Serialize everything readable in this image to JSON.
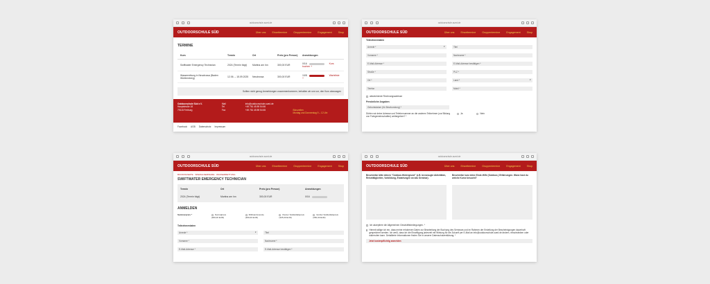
{
  "colors": {
    "brand": "#b31b1b",
    "accent": "#f3d04b"
  },
  "common": {
    "url": "outdoorschule-sued.de",
    "brand": "OUTDOORSCHULE SÜD",
    "menu": [
      "Über uns",
      "Einzeltermine",
      "Gruppentermine",
      "Engagement",
      "Shop"
    ]
  },
  "w1": {
    "heading": "TERMINE",
    "headers": [
      "Kurs",
      "Termin",
      "Ort",
      "Preis (pro Person)",
      "Anmeldungen"
    ],
    "rows": [
      {
        "kurs": "Swiftwater Emergency Technician",
        "termin": "2024 (Termin folgt)",
        "ort": "Martina am Inn",
        "preis": "300,00 EUR",
        "count": "0/16",
        "action": "Kurs buchen"
      },
      {
        "kurs": "Wasserrettung in Neudrossa (Baden Württemberg)",
        "termin": "12.06. – 15.09.2025",
        "ort": "Neudrossa",
        "preis": "300,00 EUR",
        "count": "10/8",
        "action": "Warteliste"
      }
    ],
    "notice": "Sollten nicht genug Anmeldungen zusammenkommen, behalten wir uns vor, den Kurs abzusagen",
    "footer": {
      "c1": [
        "Outdoorschule Süd e.V.",
        "Hauptstraße 18",
        "79115 Freiburg"
      ],
      "c2": [
        "Mail",
        "Tel",
        "Fax"
      ],
      "c3": [
        "info@outdoorschule-sued.de",
        "+49 761 45 89 54 66",
        "+49 761 45 89 54 65"
      ],
      "c4": [
        "",
        "",
        "Bürozeiten",
        "Montag und Donnerstag 9 – 12 Uhr"
      ]
    },
    "legal": [
      "Facebook",
      "AGB",
      "Datenschutz",
      "Impressum"
    ]
  },
  "w2": {
    "section": "Teilnehmerdaten",
    "fields": [
      [
        "Anrede *",
        "Titel"
      ],
      [
        "Vorname *",
        "Nachname *"
      ],
      [
        "E-Mail-Adresse *",
        "E-Mail-Adresse bestätigen *"
      ],
      [
        "Straße *",
        "PLZ *"
      ],
      [
        "Ort *",
        "Land *"
      ],
      [
        "Telefon",
        "Mobil *"
      ]
    ],
    "check": "abweichende Rechnungsadresse",
    "personal": "Persönliche Angaben",
    "birth": "Geburtsdatum (für Beurkundung) *",
    "question": "Dürfen wir deine Adresse und Telefonnummer an die anderen Teilnehmer (zur Bildung von Fahrgemeinschaften) weitergeben? *",
    "yes": "Ja",
    "no": "Nein"
  },
  "w3": {
    "crumb": "BOOKINGSEITE · SPEZIALSEMINARE · WASSERRETTUNG",
    "title": "SWIFTWATER EMERGENCY TECHNICIAN",
    "headers": [
      "Termin",
      "Ort",
      "Preis (pro Person)",
      "Anmeldungen"
    ],
    "row": [
      "2024 (Termin folgt)",
      "Martina am Inn",
      "300,00 EUR",
      "0/16"
    ],
    "anmelden": "ANMELDEN",
    "preis_label": "Seminarpreis *",
    "prices": [
      [
        "Normalpreis",
        "(300,00 EUR)"
      ],
      [
        "Mitfinanzierende",
        "(300,00 EUR)"
      ],
      [
        "Kleiner Solidaritätspreis",
        "(325,00 EUR)"
      ],
      [
        "Großer Solidaritätspreis",
        "(350,00 EUR)"
      ]
    ],
    "section": "Teilnehmerdaten",
    "fields": [
      [
        "Anrede *",
        "Titel"
      ],
      [
        "Vorname *",
        "Nachname *"
      ],
      [
        "E-Mail-Adresse *",
        "E-Mail-Adresse bestätigen *"
      ]
    ]
  },
  "w4": {
    "q1": "Beschreibe bitte deinen \"Outdoor-Hintergrund\" (z.B. bevorzugte Aktivitäten, Reisetätigkeiten, Vorbildung, Erwartungen an das Seminar).",
    "q2": "Beschreibe kurz deine Erste-Hilfe (Outdoor-) Erfahrungen. Wann hast du welche Kurse besucht?",
    "agb": "Ich akzeptiere die Allgemeinen Geschäftsbedingungen. *",
    "consent": "Hiermit willige ich ein, dass meine erhobenen Daten zur Bearbeitung der Buchung des Seminars und im Rahmen der Erstellung der Bescheinigungen dauerhaft gespeichert werden. Ich weiß, dass ich die Einwilligung jederzeit mit Wirkung für die Zukunft per E-Mail an info@outdoorschule-sued.de ändern, einschränken oder widerrufen kann. Detaillierte Informationen finden Sie in unserer Datenschutzerklärung. *",
    "submit": "Jetzt kostenpflichtig anmelden"
  }
}
